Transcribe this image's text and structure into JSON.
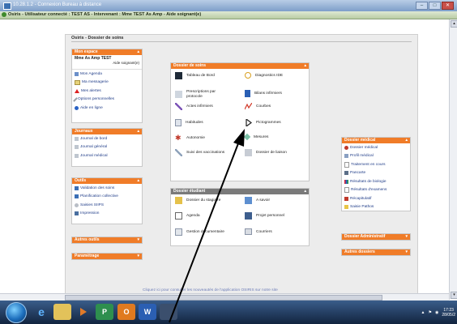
{
  "rdp": {
    "title": "10.28.1.2 - Connexion Bureau à distance"
  },
  "browser": {
    "title": "Osiris - Utilisateur connecté : TEST AS - Intervenant : Mme TEST As Amp - Aide soignant(e)"
  },
  "page": {
    "title": "Osiris - Dossier de soins",
    "footer_link": "Cliquez ici pour consulter les nouveautés de l'application OSIRIS sur notre site"
  },
  "left": {
    "mon_espace": {
      "title": "Mon espace",
      "user_name": "Mme As Amp TEST",
      "user_role": "Aide soignant(e)",
      "items": [
        "Mon Agenda",
        "Ma messagerie",
        "Mes alertes",
        "Options personnelles",
        "Aide en ligne"
      ]
    },
    "journaux": {
      "title": "Journaux",
      "items": [
        "Journal de bord",
        "Journal général",
        "Journal médical"
      ]
    },
    "outils": {
      "title": "Outils",
      "items": [
        "Validation des soins",
        "Planification collective",
        "Saisies SIIPS",
        "Impression"
      ]
    },
    "autres_outils": {
      "title": "Autres outils"
    },
    "parametrage": {
      "title": "Paramétrage"
    }
  },
  "center": {
    "dossier_soins": {
      "title": "Dossier de soins",
      "items": [
        {
          "label": "Tableau de Bord",
          "icon": "dashboard-icon"
        },
        {
          "label": "Diagnostics IDE",
          "icon": "diagnostic-icon"
        },
        {
          "label": "Prescriptions par protocole",
          "icon": "prescription-icon"
        },
        {
          "label": "Bilans infirmiers",
          "icon": "book-icon"
        },
        {
          "label": "Actes infirmiers",
          "icon": "syringe-icon"
        },
        {
          "label": "Courbes",
          "icon": "chart-icon"
        },
        {
          "label": "Habitudes",
          "icon": "habits-icon"
        },
        {
          "label": "Pictogrammes",
          "icon": "pictogram-icon"
        },
        {
          "label": "Autonomie",
          "icon": "autonomy-icon"
        },
        {
          "label": "Mesures",
          "icon": "measure-icon"
        },
        {
          "label": "Suivi des vaccinations",
          "icon": "vaccine-icon"
        },
        {
          "label": "Dossier de liaison",
          "icon": "liaison-icon"
        }
      ]
    },
    "dossier_etudiant": {
      "title": "Dossier étudiant",
      "items": [
        {
          "label": "Dossier du stagiaire",
          "icon": "student-folder-icon"
        },
        {
          "label": "A savoir",
          "icon": "info-icon"
        },
        {
          "label": "Agenda",
          "icon": "agenda-icon"
        },
        {
          "label": "Projet personnel",
          "icon": "project-icon"
        },
        {
          "label": "Gestion documentaire",
          "icon": "documents-icon"
        },
        {
          "label": "Courriers",
          "icon": "mail-icon"
        }
      ]
    }
  },
  "right": {
    "dossier_medical": {
      "title": "Dossier médical",
      "items": [
        "Dossier médical",
        "Profil médical",
        "Traitement en cours",
        "Pancarte",
        "Résultats de biologie",
        "Résultats d'examens",
        "Récapitulatif",
        "Saisie Pathos"
      ]
    },
    "dossier_administratif": {
      "title": "Dossier Administratif"
    },
    "autres_dossiers": {
      "title": "Autres dossiers"
    }
  },
  "taskbar": {
    "clock_time": "17:23",
    "clock_date": "28/05/2"
  },
  "colors": {
    "panel_header": "#f07c28",
    "student_header": "#7a7a7a",
    "link": "#1f3c88"
  }
}
